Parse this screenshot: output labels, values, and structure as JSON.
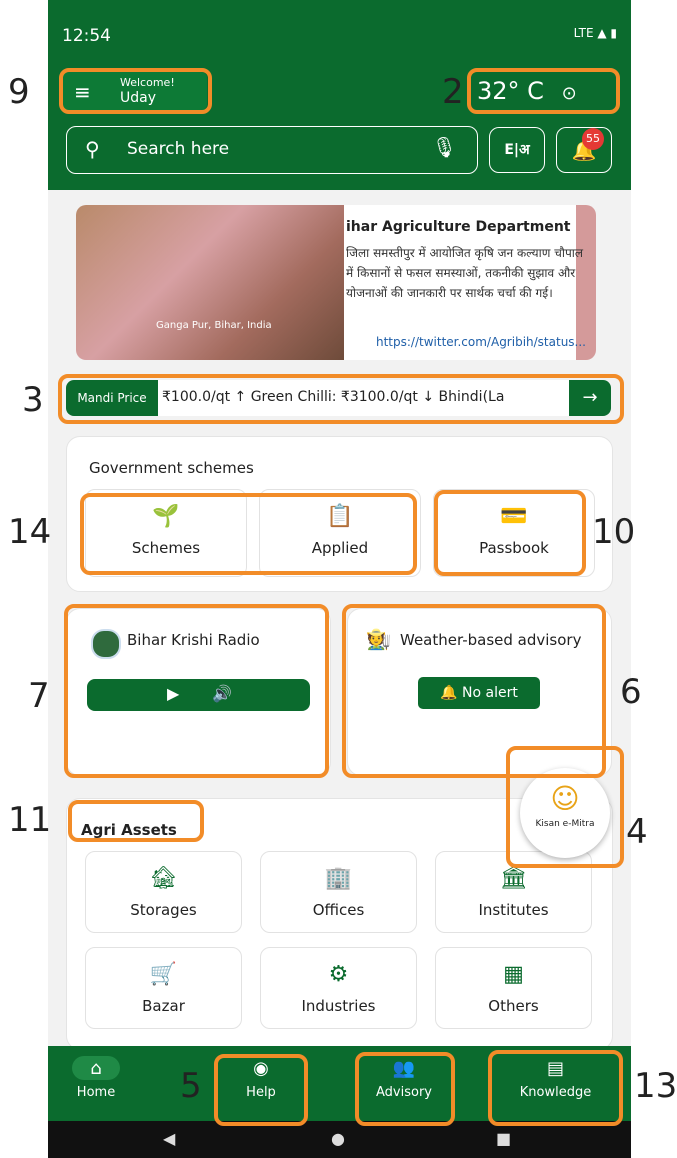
{
  "status_bar": {
    "time": "12:54",
    "icons": "LTE ▲ ▮"
  },
  "header": {
    "welcome": "Welcome!",
    "user": "Uday",
    "temperature": "32° C",
    "search_placeholder": "Search here",
    "notification_count": "55",
    "lang_label": "E|अ"
  },
  "banner": {
    "title": "ihar    Agriculture Department",
    "text": "जिला समस्तीपुर में आयोजित कृषि जन कल्याण चौपाल में किसानों से फसल समस्याओं, तकनीकी सुझाव और योजनाओं की जानकारी पर सार्थक चर्चा की गई।",
    "link": "https://twitter.com/Agribih/status...",
    "photo_caption": "Ganga Pur, Bihar, India"
  },
  "ticker": {
    "label": "Mandi Price",
    "text": "₹100.0/qt  ↑  Green Chilli: ₹3100.0/qt  ↓  Bhindi(La"
  },
  "gov_schemes": {
    "title": "Government schemes",
    "items": [
      {
        "label": "Schemes",
        "icon": "🌱"
      },
      {
        "label": "Applied",
        "icon": "📋"
      },
      {
        "label": "Passbook",
        "icon": "💳"
      }
    ]
  },
  "radio": {
    "title": "Bihar Krishi Radio",
    "play": "▶",
    "volume": "🔊"
  },
  "advisory_card": {
    "title": "Weather-based advisory",
    "no_alert": "🔔 No alert"
  },
  "agri_assets": {
    "title": "Agri Assets",
    "items": [
      {
        "label": "Storages",
        "icon": "🏚"
      },
      {
        "label": "Offices",
        "icon": "🏢"
      },
      {
        "label": "Institutes",
        "icon": "🏛"
      },
      {
        "label": "Bazar",
        "icon": "🛒"
      },
      {
        "label": "Industries",
        "icon": "⚙"
      },
      {
        "label": "Others",
        "icon": "▦"
      }
    ]
  },
  "fab": {
    "label": "Kisan e-Mitra",
    "icon": "☺"
  },
  "bottom_nav": {
    "items": [
      {
        "label": "Home",
        "icon": "⌂"
      },
      {
        "label": "Help",
        "icon": "◉"
      },
      {
        "label": "Advisory",
        "icon": "👥"
      },
      {
        "label": "Knowledge",
        "icon": "▤"
      }
    ]
  },
  "annotations": [
    "9",
    "2",
    "3",
    "14",
    "10",
    "7",
    "6",
    "11",
    "4",
    "5",
    "13"
  ],
  "colors": {
    "primary": "#0b6b2e",
    "annotation": "#f28c28",
    "badge": "#e53935"
  }
}
